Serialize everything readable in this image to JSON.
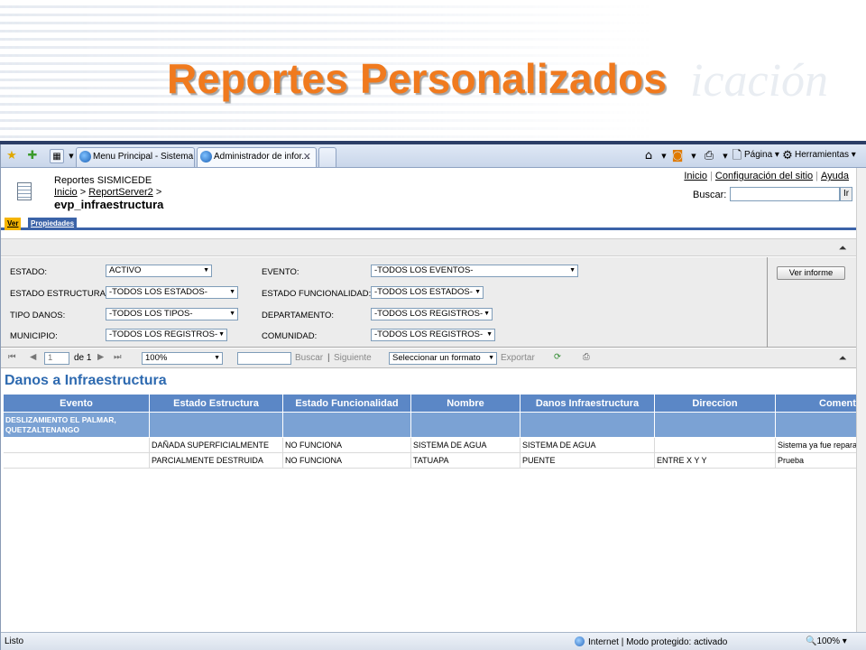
{
  "slide": {
    "title": "Reportes Personalizados",
    "watermark": "icación"
  },
  "browser": {
    "tabs": [
      {
        "label": "Menu Principal - Sistema ...",
        "active": false
      },
      {
        "label": "Administrador de infor...",
        "active": true,
        "close": "✕"
      }
    ],
    "command_bar": {
      "page_label": "Página",
      "tools_label": "Herramientas"
    },
    "status": {
      "left": "Listo",
      "zone": "Internet | Modo protegido: activado",
      "zoom": "100%"
    }
  },
  "report_manager": {
    "site_name": "Reportes SISMICEDE",
    "breadcrumb": {
      "home": "Inicio",
      "sep": ">",
      "folder": "ReportServer2"
    },
    "report_name": "evp_infraestructura",
    "top_links": [
      "Inicio",
      "Configuración del sitio",
      "Ayuda"
    ],
    "search_label": "Buscar:",
    "search_button": "Ir",
    "tabs": {
      "view": "Ver",
      "properties": "Propiedades"
    }
  },
  "parameters": [
    {
      "label": "ESTADO:",
      "value": "ACTIVO"
    },
    {
      "label": "EVENTO:",
      "value": "-TODOS LOS EVENTOS-"
    },
    {
      "label": "ESTADO ESTRUCTURA:",
      "value": "-TODOS LOS ESTADOS-"
    },
    {
      "label": "ESTADO FUNCIONALIDAD:",
      "value": "-TODOS LOS ESTADOS-"
    },
    {
      "label": "TIPO DANOS:",
      "value": "-TODOS LOS TIPOS-"
    },
    {
      "label": "DEPARTAMENTO:",
      "value": "-TODOS LOS REGISTROS-"
    },
    {
      "label": "MUNICIPIO:",
      "value": "-TODOS LOS REGISTROS-"
    },
    {
      "label": "COMUNIDAD:",
      "value": "-TODOS LOS REGISTROS-"
    }
  ],
  "view_report_button": "Ver informe",
  "toolbar": {
    "page_current": "1",
    "page_of": "de 1",
    "zoom": "100%",
    "find": "Buscar",
    "find_sep": "|",
    "next": "Siguiente",
    "format": "Seleccionar un formato",
    "export": "Exportar"
  },
  "report": {
    "title": "Danos a Infraestructura",
    "columns": [
      "Evento",
      "Estado Estructura",
      "Estado Funcionalidad",
      "Nombre",
      "Danos Infraestructura",
      "Direccion",
      "Comentario"
    ],
    "group_label": "DESLIZAMIENTO EL PALMAR, QUETZALTENANGO",
    "rows": [
      [
        "",
        "DAÑADA SUPERFICIALMENTE",
        "NO FUNCIONA",
        "SISTEMA DE AGUA",
        "SISTEMA DE AGUA",
        "",
        "Sistema ya fue reparado"
      ],
      [
        "",
        "PARCIALMENTE DESTRUIDA",
        "NO FUNCIONA",
        "TATUAPA",
        "PUENTE",
        "ENTRE X Y Y",
        "Prueba"
      ]
    ]
  }
}
